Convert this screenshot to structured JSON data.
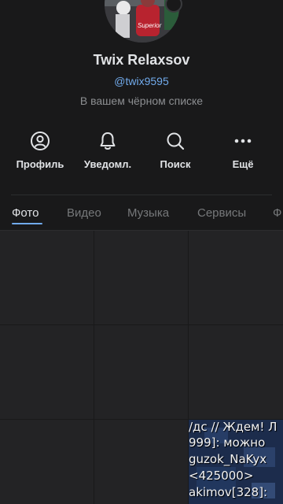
{
  "profile": {
    "name": "Twix Relaxsov",
    "handle": "@twix9595",
    "status": "В вашем чёрном списке",
    "avatar_caption": "Superior"
  },
  "actions": [
    {
      "label": "Профиль",
      "icon": "profile-icon"
    },
    {
      "label": "Уведомл.",
      "icon": "bell-icon"
    },
    {
      "label": "Поиск",
      "icon": "search-icon"
    },
    {
      "label": "Ещё",
      "icon": "more-icon"
    }
  ],
  "tabs": [
    {
      "label": "Фото",
      "active": true
    },
    {
      "label": "Видео",
      "active": false
    },
    {
      "label": "Музыка",
      "active": false
    },
    {
      "label": "Сервисы",
      "active": false
    },
    {
      "label": "Ф",
      "active": false
    }
  ],
  "photo_overlay_lines": [
    "/дс // Ждем! Л",
    "999]: можно",
    "guzok_NaKyx",
    "<425000>",
    "akimov[328]:"
  ],
  "colors": {
    "background": "#19191a",
    "accent": "#71aaeb",
    "text_primary": "#e1e3e6",
    "text_secondary": "#8c8e91",
    "tab_inactive": "#76787a",
    "grid_cell": "#232325"
  }
}
